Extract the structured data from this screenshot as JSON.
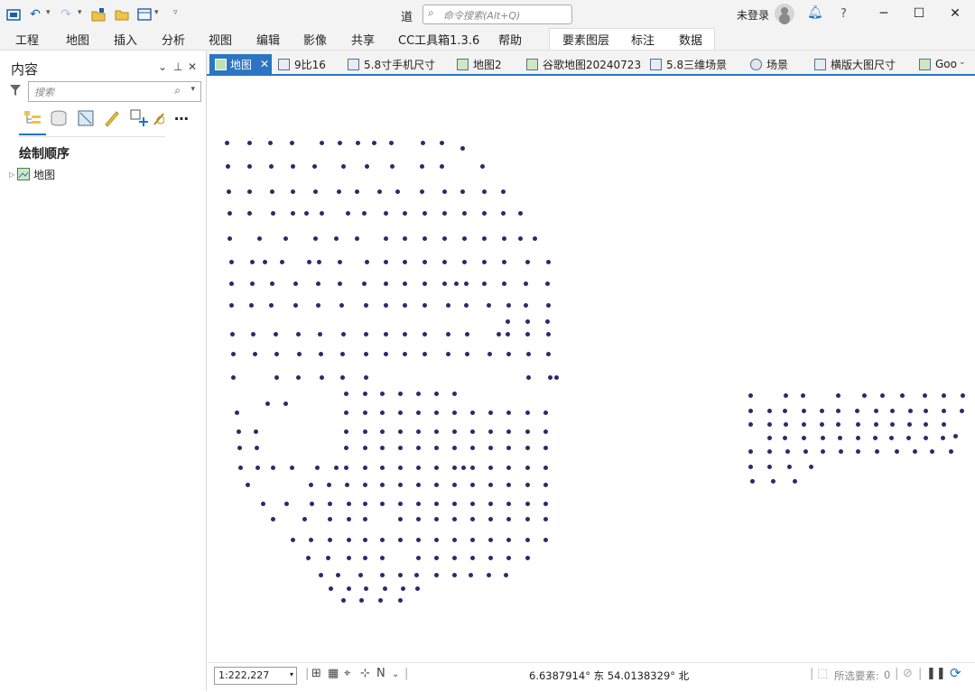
{
  "titlebar": {
    "document_title": "道",
    "command_search_placeholder": "命令搜索(Alt+Q)",
    "login_label": "未登录",
    "help_label": "?"
  },
  "ribbon": {
    "tabs": [
      "工程",
      "地图",
      "插入",
      "分析",
      "视图",
      "编辑",
      "影像",
      "共享",
      "CC工具箱1.3.6",
      "帮助"
    ],
    "contextual_tabs": [
      "要素图层",
      "标注",
      "数据"
    ]
  },
  "contents_pane": {
    "title": "内容",
    "search_placeholder": "搜索",
    "section_title": "绘制顺序",
    "layers": [
      {
        "label": "地图"
      }
    ]
  },
  "map_tabs": [
    {
      "label": "地图",
      "active": true
    },
    {
      "label": "9比16"
    },
    {
      "label": "5.8寸手机尺寸"
    },
    {
      "label": "地图2"
    },
    {
      "label": "谷歌地图20240723"
    },
    {
      "label": "5.8三维场景"
    },
    {
      "label": "场景"
    },
    {
      "label": "横版大图尺寸"
    },
    {
      "label": "Goog"
    }
  ],
  "statusbar": {
    "scale": "1:222,227",
    "coordinates": "6.6387914° 东 54.0138329° 北",
    "selected_features_label": "所选要素:",
    "selected_features_count": "0"
  },
  "colors": {
    "accent": "#2b75c2",
    "point_symbol": "#2b2a6e"
  }
}
